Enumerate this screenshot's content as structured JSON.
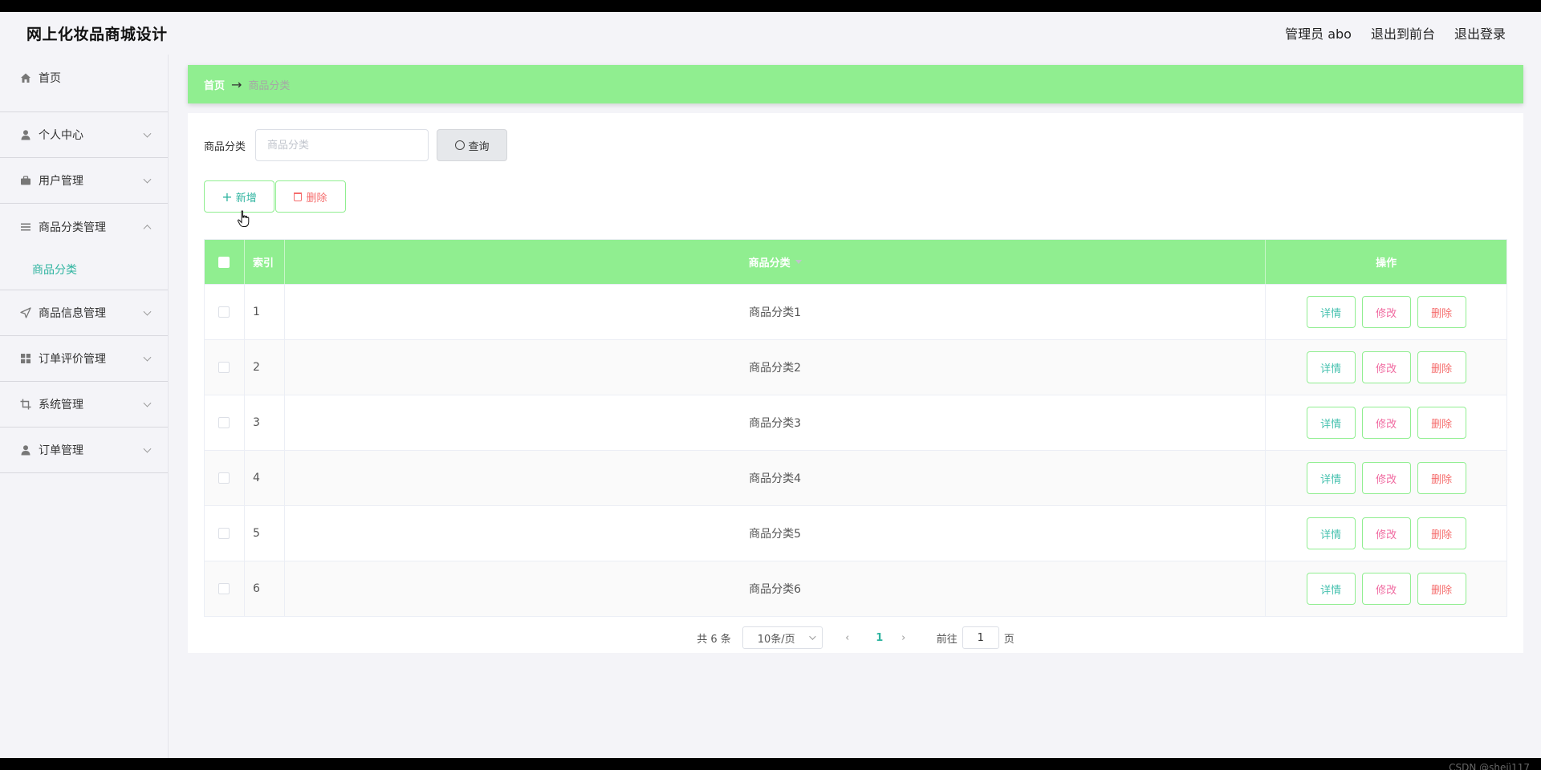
{
  "header": {
    "app_title": "网上化妆品商城设计",
    "admin": "管理员 abo",
    "front": "退出到前台",
    "logout": "退出登录"
  },
  "sidebar": {
    "home": "首页",
    "items": [
      {
        "label": "个人中心",
        "icon": "user-icon"
      },
      {
        "label": "用户管理",
        "icon": "briefcase-icon"
      },
      {
        "label": "商品分类管理",
        "icon": "menu-icon",
        "open": true,
        "sub": [
          "商品分类"
        ]
      },
      {
        "label": "商品信息管理",
        "icon": "send-icon"
      },
      {
        "label": "订单评价管理",
        "icon": "grid-icon"
      },
      {
        "label": "系统管理",
        "icon": "crop-icon"
      },
      {
        "label": "订单管理",
        "icon": "user-icon"
      }
    ]
  },
  "breadcrumb": {
    "home": "首页",
    "arrow": "→",
    "current": "商品分类"
  },
  "search": {
    "label": "商品分类",
    "placeholder": "商品分类",
    "value": "",
    "button": "查询"
  },
  "actions": {
    "add": "新增",
    "delete": "删除"
  },
  "table": {
    "headers": {
      "index": "索引",
      "name": "商品分类",
      "ops": "操作"
    },
    "rows": [
      {
        "index": "1",
        "name": "商品分类1"
      },
      {
        "index": "2",
        "name": "商品分类2"
      },
      {
        "index": "3",
        "name": "商品分类3"
      },
      {
        "index": "4",
        "name": "商品分类4"
      },
      {
        "index": "5",
        "name": "商品分类5"
      },
      {
        "index": "6",
        "name": "商品分类6"
      }
    ],
    "ops": {
      "detail": "详情",
      "edit": "修改",
      "delete": "删除"
    }
  },
  "pagination": {
    "total": "共 6 条",
    "page_size": "10条/页",
    "current": "1",
    "goto_label": "前往",
    "goto_value": "1",
    "page_suffix": "页"
  },
  "watermark": "CSDN @shejì117",
  "colors": {
    "accent_green": "#90ee90",
    "teal": "#2fb4a0",
    "danger": "#f56c6c",
    "pink": "#f06aa0"
  }
}
